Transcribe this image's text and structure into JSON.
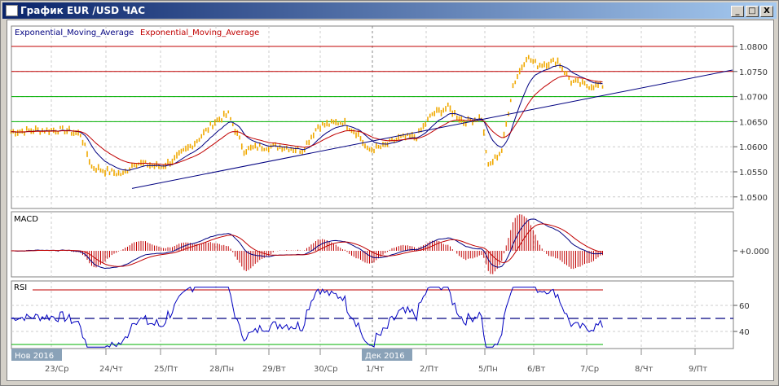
{
  "window": {
    "title": "График EUR /USD  ЧАС",
    "minimize": "_",
    "maximize": "□",
    "close": "X"
  },
  "legend": {
    "ema1": "Exponential_Moving_Average",
    "ema2": "Exponential_Moving_Average"
  },
  "panels": {
    "macd": "MACD",
    "rsi": "RSI"
  },
  "colors": {
    "candle": "#f0a800",
    "ema_fast": "#000080",
    "ema_slow": "#c00000",
    "resistance": "#c00000",
    "support": "#00b000",
    "trend": "#000080"
  },
  "chart_data": {
    "type": "line",
    "title": "График EUR /USD  ЧАС",
    "price_axis": {
      "ticks": [
        "1.0800",
        "1.0750",
        "1.0700",
        "1.0650",
        "1.0600",
        "1.0550",
        "1.0500"
      ],
      "range": [
        1.049,
        1.0845
      ]
    },
    "x_ticks": [
      "23/Ср",
      "24/Чт",
      "25/Пт",
      "28/Пн",
      "29/Вт",
      "30/Ср",
      "1/Чт",
      "2/Пт",
      "5/Пн",
      "6/Вт",
      "7/Ср",
      "8/Чт",
      "9/Пт"
    ],
    "month_labels": [
      "Нов 2016",
      "Дек 2016"
    ],
    "hline_levels": {
      "resistance": [
        1.08,
        1.075
      ],
      "support": [
        1.07,
        1.065
      ]
    },
    "trendline": {
      "from": [
        36,
        1.0517
      ],
      "to": [
        304,
        1.0753
      ]
    },
    "price_anchors": {
      "hour": [
        -18,
        -6,
        6,
        13,
        18,
        24,
        32,
        37,
        49,
        55,
        64,
        73,
        79,
        86,
        93,
        103,
        112,
        119,
        130,
        137,
        141,
        148,
        155,
        163,
        170,
        177,
        184,
        192,
        195,
        201,
        206,
        212,
        217,
        226,
        232,
        239,
        246
      ],
      "close": [
        1.063,
        1.0633,
        1.0633,
        1.0625,
        1.056,
        1.0552,
        1.0545,
        1.0568,
        1.056,
        1.0575,
        1.0608,
        1.065,
        1.0665,
        1.0593,
        1.06,
        1.06,
        1.0593,
        1.0641,
        1.065,
        1.0625,
        1.0593,
        1.06,
        1.0617,
        1.062,
        1.0665,
        1.0678,
        1.065,
        1.0658,
        1.056,
        1.0593,
        1.0722,
        1.0779,
        1.0763,
        1.0771,
        1.073,
        1.0722,
        1.0722
      ]
    },
    "macd": {
      "zero_label": "+0.000"
    },
    "rsi": {
      "ticks": [
        "60",
        "40"
      ],
      "levels": [
        70,
        50,
        30
      ]
    }
  }
}
